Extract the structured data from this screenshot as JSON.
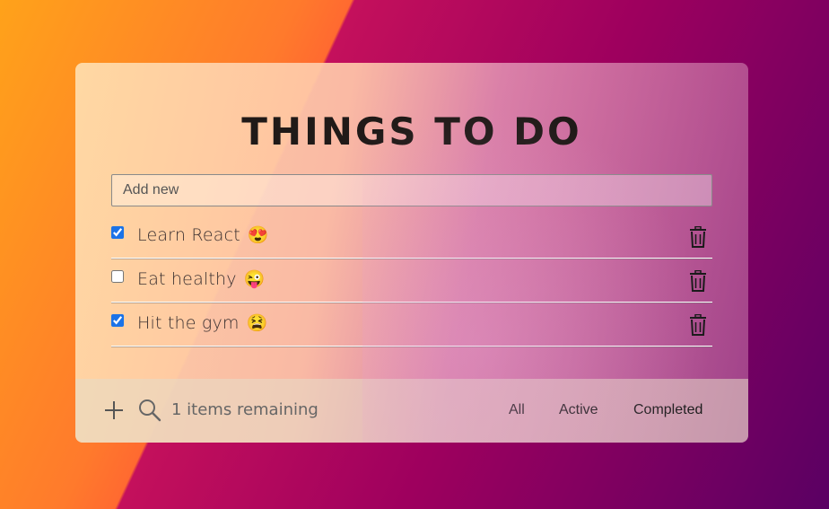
{
  "app": {
    "title": "THINGS TO DO"
  },
  "add": {
    "placeholder": "Add new",
    "value": ""
  },
  "todos": [
    {
      "label": "Learn React",
      "emoji": "😍",
      "emoji_icon": "heart-eyes-emoji",
      "checked": true
    },
    {
      "label": "Eat healthy",
      "emoji": "😜",
      "emoji_icon": "winking-tongue-emoji",
      "checked": false
    },
    {
      "label": "Hit the gym",
      "emoji": "😫",
      "emoji_icon": "tired-face-emoji",
      "checked": true
    }
  ],
  "footer": {
    "remaining": "1 items remaining",
    "filters": [
      "All",
      "Active",
      "Completed"
    ]
  },
  "icons": {
    "delete": "trash-icon",
    "add": "plus-icon",
    "search": "search-icon"
  },
  "colors": {
    "title": "#201a18",
    "checkbox": "#1a73e8"
  }
}
